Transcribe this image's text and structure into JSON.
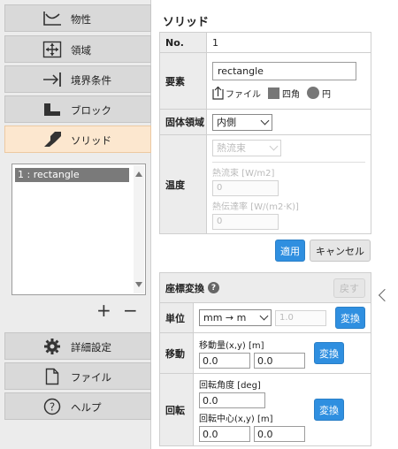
{
  "sidebar": {
    "items": [
      {
        "label": "物性",
        "icon": "graph-icon"
      },
      {
        "label": "領域",
        "icon": "move-arrows-icon"
      },
      {
        "label": "境界条件",
        "icon": "arrow-bar-icon"
      },
      {
        "label": "ブロック",
        "icon": "block-icon"
      },
      {
        "label": "ソリッド",
        "icon": "solid-shape-icon"
      },
      {
        "label": "詳細設定",
        "icon": "gear-icon"
      },
      {
        "label": "ファイル",
        "icon": "file-icon"
      },
      {
        "label": "ヘルプ",
        "icon": "help-icon"
      }
    ],
    "active_index": 4,
    "list": {
      "items": [
        "1 : rectangle"
      ],
      "add_label": "+",
      "remove_label": "−"
    }
  },
  "panel": {
    "title": "ソリッド",
    "no": {
      "label": "No.",
      "value": "1"
    },
    "element": {
      "label": "要素",
      "name_value": "rectangle",
      "file_label": "ファイル",
      "rect_label": "四角",
      "circle_label": "円"
    },
    "solid_region": {
      "label": "固体領域",
      "value": "内側"
    },
    "temperature": {
      "label": "温度",
      "select_value": "熱流束",
      "heat_flux_label": "熱流束 [W/m2]",
      "heat_flux_value": "0",
      "heat_transfer_label": "熱伝達率 [W/(m2·K)]",
      "heat_transfer_value": "0"
    },
    "apply_label": "適用",
    "cancel_label": "キャンセル"
  },
  "transform": {
    "title": "座標変換",
    "undo_label": "戻す",
    "unit": {
      "label": "単位",
      "select_value": "mm → m",
      "factor_value": "1.0",
      "button_label": "変換"
    },
    "move": {
      "label": "移動",
      "sub_label": "移動量(x,y) [m]",
      "x_value": "0.0",
      "y_value": "0.0",
      "button_label": "変換"
    },
    "rotate": {
      "label": "回転",
      "angle_label": "回転角度 [deg]",
      "angle_value": "0.0",
      "center_label": "回転中心(x,y) [m]",
      "cx_value": "0.0",
      "cy_value": "0.0",
      "button_label": "変換"
    }
  },
  "colors": {
    "accent": "#2f8fe0",
    "active_nav": "#fce7cf",
    "nav": "#d9d9d9"
  }
}
